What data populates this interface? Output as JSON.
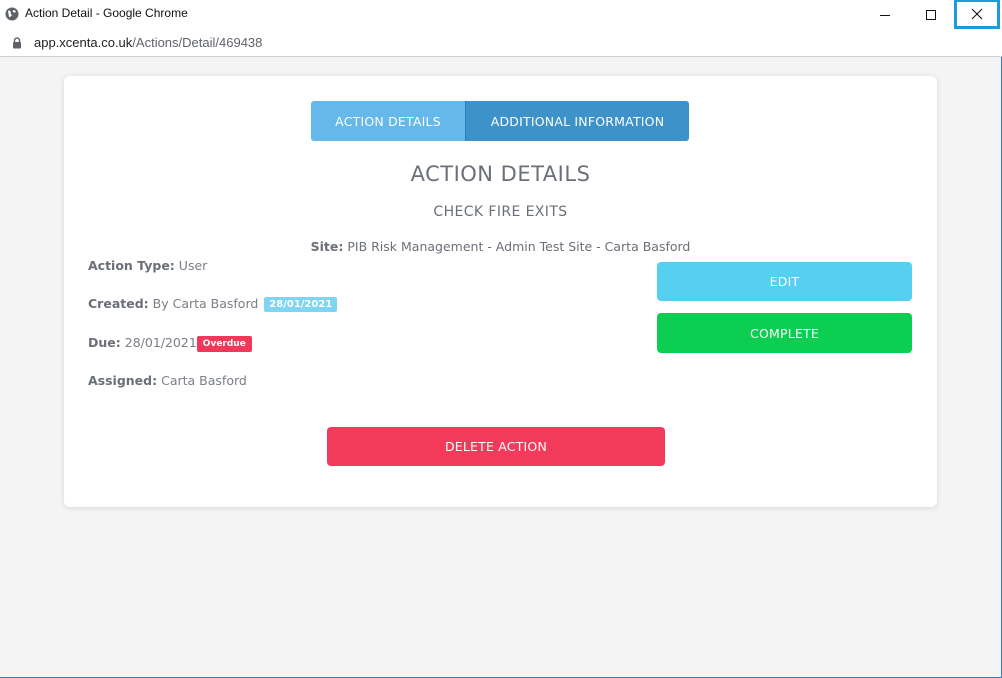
{
  "window": {
    "title": "Action Detail - Google Chrome",
    "url_domain": "app.xcenta.co.uk",
    "url_path": "/Actions/Detail/469438"
  },
  "tabs": [
    {
      "label": "ACTION DETAILS"
    },
    {
      "label": "ADDITIONAL INFORMATION"
    }
  ],
  "detail": {
    "heading": "ACTION DETAILS",
    "subheading": "CHECK FIRE EXITS",
    "site_label": "Site:",
    "site_value": "PIB Risk Management - Admin Test Site - Carta Basford",
    "action_type_label": "Action Type:",
    "action_type_value": "User",
    "created_label": "Created:",
    "created_value": "By Carta Basford",
    "created_badge": "28/01/2021",
    "due_label": "Due:",
    "due_value": "28/01/2021",
    "due_badge": "Overdue",
    "assigned_label": "Assigned:",
    "assigned_value": "Carta Basford"
  },
  "buttons": {
    "edit": "EDIT",
    "complete": "COMPLETE",
    "delete": "DELETE ACTION"
  },
  "colors": {
    "tab_active": "#64b8ea",
    "tab_inactive": "#3c92c9",
    "edit": "#56d0f0",
    "complete": "#0ccf52",
    "delete": "#f33a5b",
    "overdue": "#f0385a",
    "date_badge": "#7fd3f3"
  }
}
